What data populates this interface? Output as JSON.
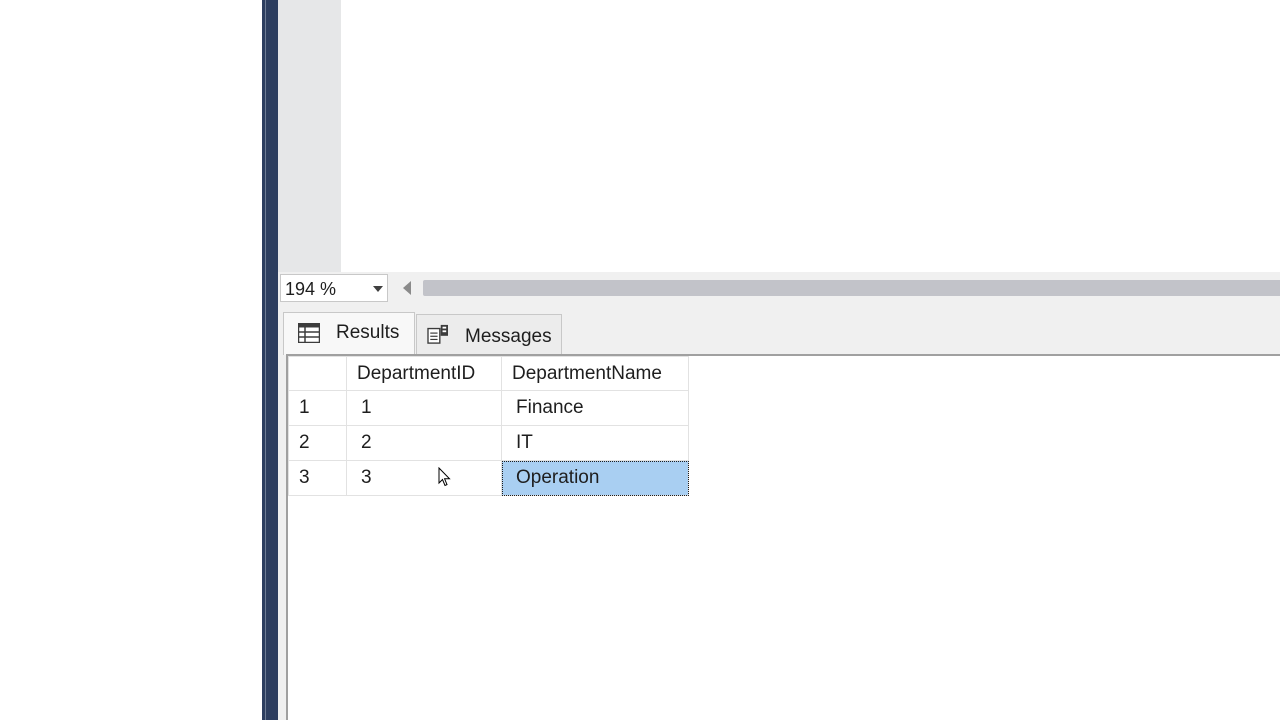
{
  "editor": {
    "zoom_level": "194 %"
  },
  "results": {
    "tabs": [
      {
        "label": "Results",
        "icon": "grid-icon",
        "active": true
      },
      {
        "label": "Messages",
        "icon": "messages-icon",
        "active": false
      }
    ],
    "columns": [
      "",
      "DepartmentID",
      "DepartmentName"
    ],
    "rows": [
      {
        "row_number": "1",
        "DepartmentID": "1",
        "DepartmentName": "Finance"
      },
      {
        "row_number": "2",
        "DepartmentID": "2",
        "DepartmentName": "IT"
      },
      {
        "row_number": "3",
        "DepartmentID": "3",
        "DepartmentName": "Operation"
      }
    ],
    "selected_cell": {
      "row": 3,
      "column": "DepartmentName"
    }
  },
  "colors": {
    "window_border": "#2d3e5f",
    "selection": "#a9cff2",
    "pane_background": "#f0f0f0"
  }
}
